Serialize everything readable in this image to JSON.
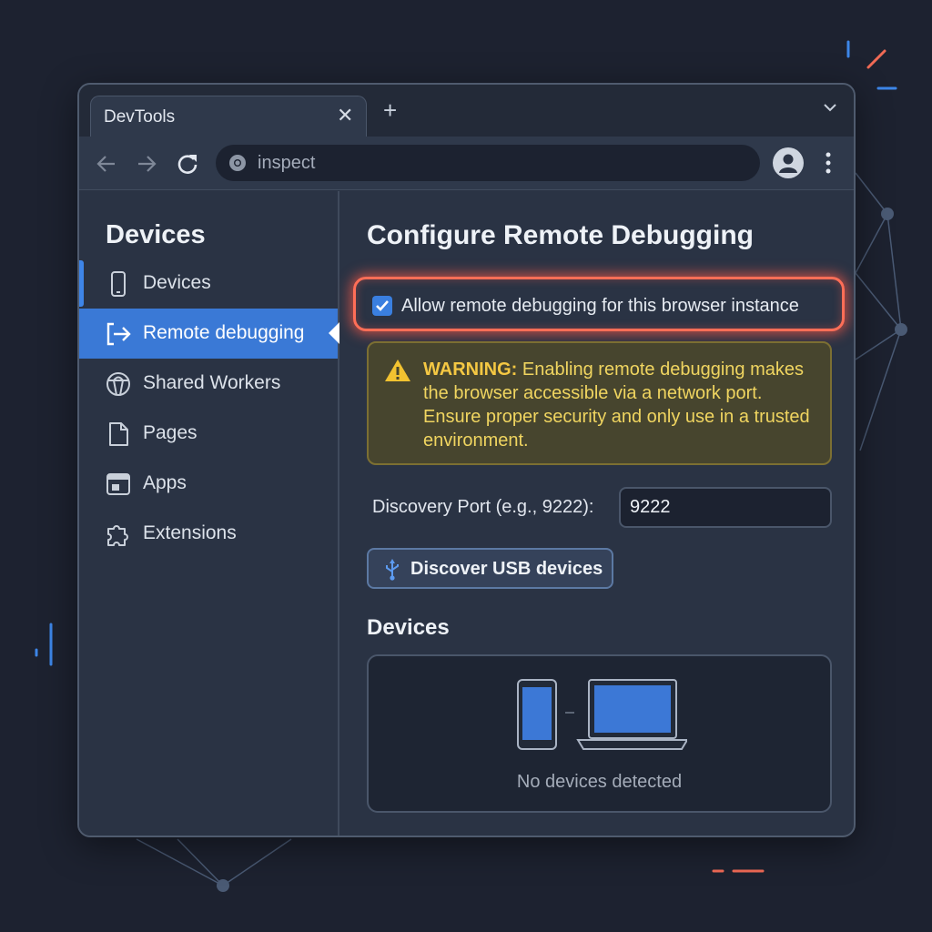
{
  "browser": {
    "tab_title": "DevTools",
    "address_text": "inspect",
    "icons": {
      "back": "arrow-left-icon",
      "forward": "arrow-right-icon",
      "reload": "reload-icon",
      "site": "chrome-icon",
      "profile": "profile-icon",
      "menu": "kebab-menu-icon",
      "new_tab": "plus-icon",
      "tab_close": "close-icon",
      "tab_menu": "chevron-down-icon"
    }
  },
  "sidebar": {
    "title": "Devices",
    "items": [
      {
        "label": "Devices",
        "icon": "phone-icon"
      },
      {
        "label": "Remote debugging",
        "icon": "remote-arrow-icon",
        "active": true
      },
      {
        "label": "Shared Workers",
        "icon": "shared-workers-icon"
      },
      {
        "label": "Pages",
        "icon": "page-icon"
      },
      {
        "label": "Apps",
        "icon": "app-window-icon"
      },
      {
        "label": "Extensions",
        "icon": "puzzle-icon"
      }
    ]
  },
  "main": {
    "title": "Configure Remote Debugging",
    "allow_checkbox": {
      "label": "Allow remote debugging for this browser instance",
      "checked": true
    },
    "warning": {
      "prefix": "WARNING:",
      "text": " Enabling remote debugging makes the browser accessible via a network port. Ensure proper security and only use in a trusted environment."
    },
    "port": {
      "label": "Discovery Port (e.g., 9222):",
      "value": "9222"
    },
    "usb_button": {
      "label": "Discover USB devices",
      "icon": "usb-icon"
    },
    "devices": {
      "title": "Devices",
      "empty_text": "No devices detected"
    }
  },
  "colors": {
    "accent": "#3a79d6",
    "highlight": "#ff6e57",
    "warning_text": "#f0d560",
    "background": "#1d2230"
  }
}
